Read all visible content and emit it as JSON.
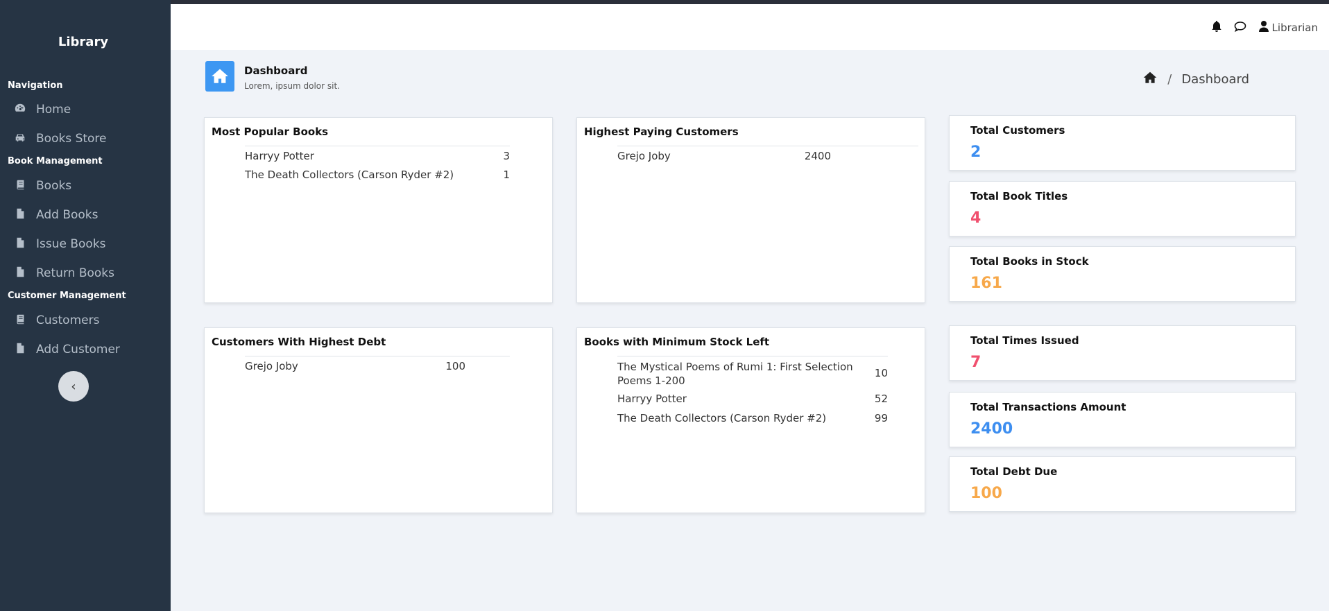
{
  "sidebar": {
    "brand": "Library",
    "sections": [
      {
        "title": "Navigation"
      },
      {
        "title": "Book Management"
      },
      {
        "title": "Customer Management"
      }
    ],
    "items": [
      {
        "label": "Home",
        "icon": "dashboard-icon"
      },
      {
        "label": "Books Store",
        "icon": "car-icon"
      },
      {
        "label": "Books",
        "icon": "book-icon"
      },
      {
        "label": "Add Books",
        "icon": "file-icon"
      },
      {
        "label": "Issue Books",
        "icon": "file-icon"
      },
      {
        "label": "Return Books",
        "icon": "file-icon"
      },
      {
        "label": "Customers",
        "icon": "book-icon"
      },
      {
        "label": "Add Customer",
        "icon": "file-icon"
      }
    ],
    "collapse_glyph": "‹"
  },
  "topbar": {
    "user_label": "Librarian"
  },
  "header": {
    "title": "Dashboard",
    "subtitle": "Lorem, ipsum dolor sit.",
    "breadcrumb_sep": "/",
    "breadcrumb_current": "Dashboard"
  },
  "popular_books": {
    "title": "Most Popular Books",
    "rows": [
      {
        "name": "Harryy Potter",
        "value": "3"
      },
      {
        "name": "The Death Collectors (Carson Ryder #2)",
        "value": "1"
      }
    ]
  },
  "highest_paying": {
    "title": "Highest Paying Customers",
    "rows": [
      {
        "name": "Grejo Joby",
        "value": "2400"
      }
    ]
  },
  "highest_debt": {
    "title": "Customers With Highest Debt",
    "rows": [
      {
        "name": "Grejo Joby",
        "value": "100"
      }
    ]
  },
  "min_stock": {
    "title": "Books with Minimum Stock Left",
    "rows": [
      {
        "name": "The Mystical Poems of Rumi 1: First Selection Poems 1-200",
        "value": "10"
      },
      {
        "name": "Harryy Potter",
        "value": "52"
      },
      {
        "name": "The Death Collectors (Carson Ryder #2)",
        "value": "99"
      }
    ]
  },
  "stats": [
    {
      "label": "Total Customers",
      "value": "2",
      "color": "#3d8ef0"
    },
    {
      "label": "Total Book Titles",
      "value": "4",
      "color": "#f0506e"
    },
    {
      "label": "Total Books in Stock",
      "value": "161",
      "color": "#f7a84a"
    },
    {
      "label": "Total Times Issued",
      "value": "7",
      "color": "#f0506e"
    },
    {
      "label": "Total Transactions Amount",
      "value": "2400",
      "color": "#3d8ef0"
    },
    {
      "label": "Total Debt Due",
      "value": "100",
      "color": "#f7a84a"
    }
  ]
}
